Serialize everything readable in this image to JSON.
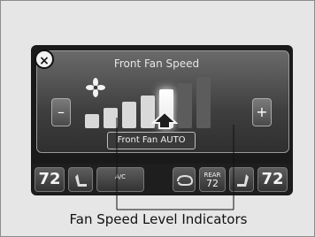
{
  "screen": {
    "title": "Front Fan Speed",
    "auto_button_label": "Front Fan AUTO",
    "minus_label": "–",
    "plus_label": "+",
    "close_icon": "close-icon",
    "fan_icon": "fan-icon",
    "fan_speed": {
      "levels_total": 7,
      "current_level": 5
    }
  },
  "bottom_bar": {
    "left_temp": "72",
    "right_temp": "72",
    "ac_label": "A/C",
    "rear_label": "REAR",
    "rear_temp": "72"
  },
  "caption": {
    "text": "Fan Speed Level Indicators"
  }
}
